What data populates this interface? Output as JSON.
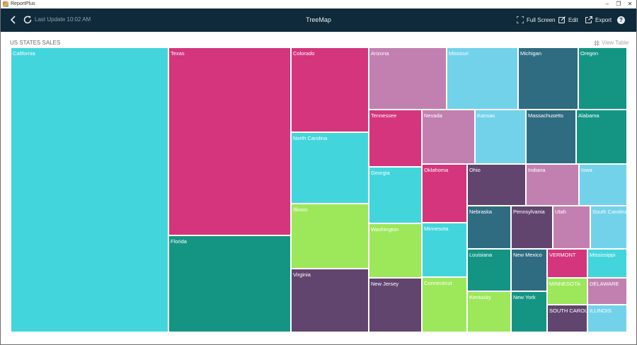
{
  "window": {
    "title": "ReportPlus",
    "minimize": "–",
    "maximize": "❐",
    "close": "✕"
  },
  "toolbar": {
    "last_update": "Last Update 10:02 AM",
    "title": "TreeMap",
    "fullscreen_label": "Full Screen",
    "edit_label": "Edit",
    "export_label": "Export",
    "help_label": "?"
  },
  "section": {
    "title": "US STATES SALES",
    "view_table_label": "View Table"
  },
  "colors": {
    "toolbar_bg": "#0f2a3a",
    "cyan": "#43d5dc",
    "magenta": "#d4357d",
    "teal": "#149584",
    "lime": "#9de75a",
    "plum": "#62456e",
    "mauve": "#c280b0",
    "sky": "#72d2ea",
    "slate": "#2f6c81"
  },
  "treemap": {
    "states": [
      "California",
      "Texas",
      "Florida",
      "Colorado",
      "North Carolina",
      "Illinois",
      "Virginia",
      "Arizona",
      "Missouri",
      "Michigan",
      "Oregon",
      "Tennessee",
      "Nevada",
      "Kansas",
      "Massachusetts",
      "Alabama",
      "Georgia",
      "Oklahoma",
      "Ohio",
      "Indiana",
      "Iowa",
      "Washington",
      "Minnesota",
      "Nebraska",
      "Pennsylvania",
      "Utah",
      "South Carolina",
      "New Jersey",
      "Connecticut",
      "Louisiana",
      "New Mexico",
      "VERMONT",
      "Mississippi",
      "Kentucky",
      "New York",
      "MINNESOTA",
      "DELAWARE",
      "SOUTH CAROLINA",
      "ILLINOIS"
    ],
    "labels": {
      "California": "California",
      "Texas": "Texas",
      "Florida": "Florida",
      "Colorado": "Colorado",
      "North Carolina": "North Carolina",
      "Illinois": "Illinois",
      "Virginia": "Virginia",
      "Arizona": "Arizona",
      "Missouri": "Missouri",
      "Michigan": "Michigan",
      "Oregon": "Oregon",
      "Tennessee": "Tennessee",
      "Nevada": "Nevada",
      "Kansas": "Kansas",
      "Massachusetts": "Massachusetts",
      "Alabama": "Alabama",
      "Georgia": "Georgia",
      "Oklahoma": "Oklahoma",
      "Ohio": "Ohio",
      "Indiana": "Indiana",
      "Iowa": "Iowa",
      "Washington": "Washington",
      "Minnesota": "Minnesota",
      "Nebraska": "Nebraska",
      "Pennsylvania": "Pennsylvania",
      "Utah": "Utah",
      "South Carolina": "South Carolina",
      "New Jersey": "New Jersey",
      "Connecticut": "Connecticut",
      "Louisiana": "Louisiana",
      "New Mexico": "New Mexico",
      "VERMONT": "VERMONT",
      "Mississippi": "Mississippi",
      "Kentucky": "Kentucky",
      "New York": "New York",
      "MINNESOTA": "MINNESOTA",
      "DELAWARE": "DELAWARE",
      "SOUTH CAROLINA": "SOUTH CAROLI",
      "ILLINOIS": "ILLINOIS"
    },
    "cell_colors": {
      "California": "#43d5dc",
      "Texas": "#d4357d",
      "Florida": "#149584",
      "Colorado": "#d4357d",
      "North Carolina": "#43d5dc",
      "Illinois": "#9de75a",
      "Virginia": "#62456e",
      "Arizona": "#c280b0",
      "Missouri": "#72d2ea",
      "Michigan": "#2f6c81",
      "Oregon": "#149584",
      "Tennessee": "#d4357d",
      "Nevada": "#c280b0",
      "Kansas": "#72d2ea",
      "Massachusetts": "#2f6c81",
      "Alabama": "#149584",
      "Georgia": "#43d5dc",
      "Oklahoma": "#d4357d",
      "Ohio": "#62456e",
      "Indiana": "#c280b0",
      "Iowa": "#72d2ea",
      "Washington": "#9de75a",
      "Minnesota": "#43d5dc",
      "Nebraska": "#2f6c81",
      "Pennsylvania": "#62456e",
      "Utah": "#c280b0",
      "South Carolina": "#72d2ea",
      "New Jersey": "#62456e",
      "Connecticut": "#9de75a",
      "Louisiana": "#149584",
      "New Mexico": "#2f6c81",
      "VERMONT": "#d4357d",
      "Mississippi": "#43d5dc",
      "Kentucky": "#9de75a",
      "New York": "#149584",
      "MINNESOTA": "#9de75a",
      "DELAWARE": "#c280b0",
      "SOUTH CAROLINA": "#62456e",
      "ILLINOIS": "#72d2ea"
    }
  }
}
